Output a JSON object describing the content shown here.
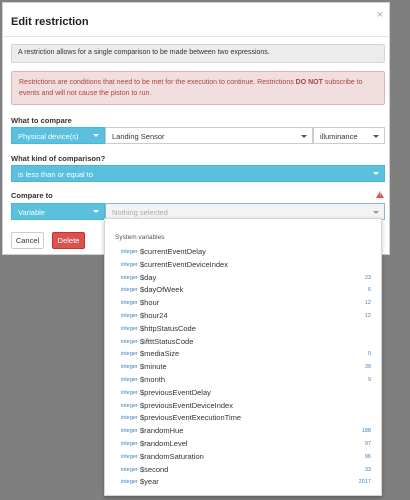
{
  "dialog": {
    "title": "Edit restriction",
    "close_glyph": "×",
    "info_text": "A restriction allows for a single comparison to be made between two expressions.",
    "alert_part1": "Restrictions are conditions that need to be met for the execution to continue. Restrictions ",
    "alert_bold": "DO NOT",
    "alert_part2": " subscribe to events and will not cause the piston to run."
  },
  "compare": {
    "label": "What to compare",
    "source": "Physical device(s)",
    "device": "Landing Sensor",
    "attribute": "illuminance"
  },
  "comparison": {
    "label": "What kind of comparison?",
    "value": "is less than or equal to"
  },
  "compare_to": {
    "label": "Compare to",
    "source": "Variable",
    "placeholder": "Nothing selected"
  },
  "buttons": {
    "cancel": "Cancel",
    "delete": "Delete"
  },
  "dropdown": {
    "header": "System variables",
    "items": [
      {
        "type": "integer",
        "name": "$currentEventDelay",
        "value": ""
      },
      {
        "type": "integer",
        "name": "$currentEventDeviceIndex",
        "value": ""
      },
      {
        "type": "integer",
        "name": "$day",
        "value": "23"
      },
      {
        "type": "integer",
        "name": "$dayOfWeek",
        "value": "6"
      },
      {
        "type": "integer",
        "name": "$hour",
        "value": "12"
      },
      {
        "type": "integer",
        "name": "$hour24",
        "value": "12"
      },
      {
        "type": "integer",
        "name": "$httpStatusCode",
        "value": ""
      },
      {
        "type": "integer",
        "name": "$iftttStatusCode",
        "value": ""
      },
      {
        "type": "integer",
        "name": "$mediaSize",
        "value": "0"
      },
      {
        "type": "integer",
        "name": "$minute",
        "value": "39"
      },
      {
        "type": "integer",
        "name": "$month",
        "value": "9"
      },
      {
        "type": "integer",
        "name": "$previousEventDelay",
        "value": ""
      },
      {
        "type": "integer",
        "name": "$previousEventDeviceIndex",
        "value": ""
      },
      {
        "type": "integer",
        "name": "$previousEventExecutionTime",
        "value": ""
      },
      {
        "type": "integer",
        "name": "$randomHue",
        "value": "188"
      },
      {
        "type": "integer",
        "name": "$randomLevel",
        "value": "97"
      },
      {
        "type": "integer",
        "name": "$randomSaturation",
        "value": "96"
      },
      {
        "type": "integer",
        "name": "$second",
        "value": "33"
      },
      {
        "type": "integer",
        "name": "$year",
        "value": "2017"
      }
    ]
  }
}
